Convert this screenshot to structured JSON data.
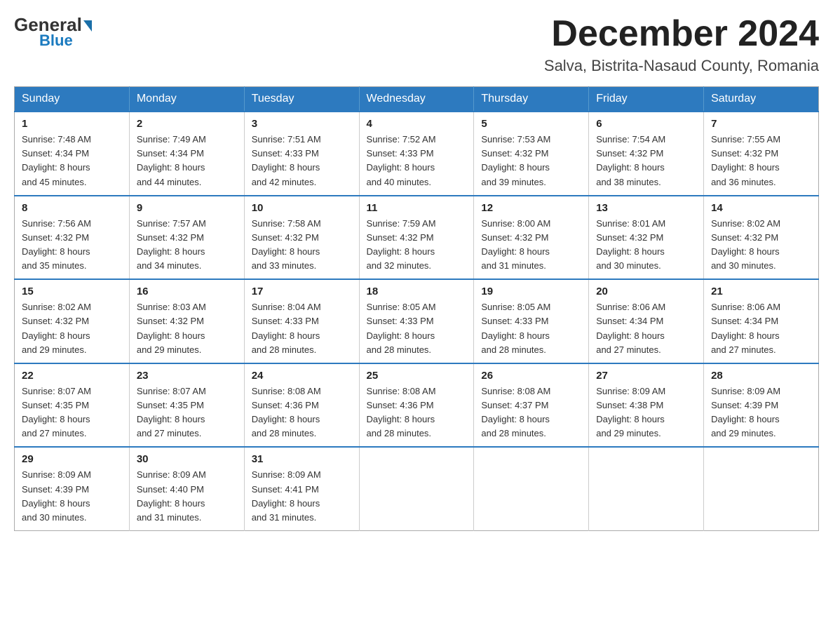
{
  "header": {
    "logo_general": "General",
    "logo_blue": "Blue",
    "month_title": "December 2024",
    "location": "Salva, Bistrita-Nasaud County, Romania"
  },
  "weekdays": [
    "Sunday",
    "Monday",
    "Tuesday",
    "Wednesday",
    "Thursday",
    "Friday",
    "Saturday"
  ],
  "weeks": [
    [
      {
        "day": "1",
        "info": "Sunrise: 7:48 AM\nSunset: 4:34 PM\nDaylight: 8 hours\nand 45 minutes."
      },
      {
        "day": "2",
        "info": "Sunrise: 7:49 AM\nSunset: 4:34 PM\nDaylight: 8 hours\nand 44 minutes."
      },
      {
        "day": "3",
        "info": "Sunrise: 7:51 AM\nSunset: 4:33 PM\nDaylight: 8 hours\nand 42 minutes."
      },
      {
        "day": "4",
        "info": "Sunrise: 7:52 AM\nSunset: 4:33 PM\nDaylight: 8 hours\nand 40 minutes."
      },
      {
        "day": "5",
        "info": "Sunrise: 7:53 AM\nSunset: 4:32 PM\nDaylight: 8 hours\nand 39 minutes."
      },
      {
        "day": "6",
        "info": "Sunrise: 7:54 AM\nSunset: 4:32 PM\nDaylight: 8 hours\nand 38 minutes."
      },
      {
        "day": "7",
        "info": "Sunrise: 7:55 AM\nSunset: 4:32 PM\nDaylight: 8 hours\nand 36 minutes."
      }
    ],
    [
      {
        "day": "8",
        "info": "Sunrise: 7:56 AM\nSunset: 4:32 PM\nDaylight: 8 hours\nand 35 minutes."
      },
      {
        "day": "9",
        "info": "Sunrise: 7:57 AM\nSunset: 4:32 PM\nDaylight: 8 hours\nand 34 minutes."
      },
      {
        "day": "10",
        "info": "Sunrise: 7:58 AM\nSunset: 4:32 PM\nDaylight: 8 hours\nand 33 minutes."
      },
      {
        "day": "11",
        "info": "Sunrise: 7:59 AM\nSunset: 4:32 PM\nDaylight: 8 hours\nand 32 minutes."
      },
      {
        "day": "12",
        "info": "Sunrise: 8:00 AM\nSunset: 4:32 PM\nDaylight: 8 hours\nand 31 minutes."
      },
      {
        "day": "13",
        "info": "Sunrise: 8:01 AM\nSunset: 4:32 PM\nDaylight: 8 hours\nand 30 minutes."
      },
      {
        "day": "14",
        "info": "Sunrise: 8:02 AM\nSunset: 4:32 PM\nDaylight: 8 hours\nand 30 minutes."
      }
    ],
    [
      {
        "day": "15",
        "info": "Sunrise: 8:02 AM\nSunset: 4:32 PM\nDaylight: 8 hours\nand 29 minutes."
      },
      {
        "day": "16",
        "info": "Sunrise: 8:03 AM\nSunset: 4:32 PM\nDaylight: 8 hours\nand 29 minutes."
      },
      {
        "day": "17",
        "info": "Sunrise: 8:04 AM\nSunset: 4:33 PM\nDaylight: 8 hours\nand 28 minutes."
      },
      {
        "day": "18",
        "info": "Sunrise: 8:05 AM\nSunset: 4:33 PM\nDaylight: 8 hours\nand 28 minutes."
      },
      {
        "day": "19",
        "info": "Sunrise: 8:05 AM\nSunset: 4:33 PM\nDaylight: 8 hours\nand 28 minutes."
      },
      {
        "day": "20",
        "info": "Sunrise: 8:06 AM\nSunset: 4:34 PM\nDaylight: 8 hours\nand 27 minutes."
      },
      {
        "day": "21",
        "info": "Sunrise: 8:06 AM\nSunset: 4:34 PM\nDaylight: 8 hours\nand 27 minutes."
      }
    ],
    [
      {
        "day": "22",
        "info": "Sunrise: 8:07 AM\nSunset: 4:35 PM\nDaylight: 8 hours\nand 27 minutes."
      },
      {
        "day": "23",
        "info": "Sunrise: 8:07 AM\nSunset: 4:35 PM\nDaylight: 8 hours\nand 27 minutes."
      },
      {
        "day": "24",
        "info": "Sunrise: 8:08 AM\nSunset: 4:36 PM\nDaylight: 8 hours\nand 28 minutes."
      },
      {
        "day": "25",
        "info": "Sunrise: 8:08 AM\nSunset: 4:36 PM\nDaylight: 8 hours\nand 28 minutes."
      },
      {
        "day": "26",
        "info": "Sunrise: 8:08 AM\nSunset: 4:37 PM\nDaylight: 8 hours\nand 28 minutes."
      },
      {
        "day": "27",
        "info": "Sunrise: 8:09 AM\nSunset: 4:38 PM\nDaylight: 8 hours\nand 29 minutes."
      },
      {
        "day": "28",
        "info": "Sunrise: 8:09 AM\nSunset: 4:39 PM\nDaylight: 8 hours\nand 29 minutes."
      }
    ],
    [
      {
        "day": "29",
        "info": "Sunrise: 8:09 AM\nSunset: 4:39 PM\nDaylight: 8 hours\nand 30 minutes."
      },
      {
        "day": "30",
        "info": "Sunrise: 8:09 AM\nSunset: 4:40 PM\nDaylight: 8 hours\nand 31 minutes."
      },
      {
        "day": "31",
        "info": "Sunrise: 8:09 AM\nSunset: 4:41 PM\nDaylight: 8 hours\nand 31 minutes."
      },
      {
        "day": "",
        "info": ""
      },
      {
        "day": "",
        "info": ""
      },
      {
        "day": "",
        "info": ""
      },
      {
        "day": "",
        "info": ""
      }
    ]
  ]
}
